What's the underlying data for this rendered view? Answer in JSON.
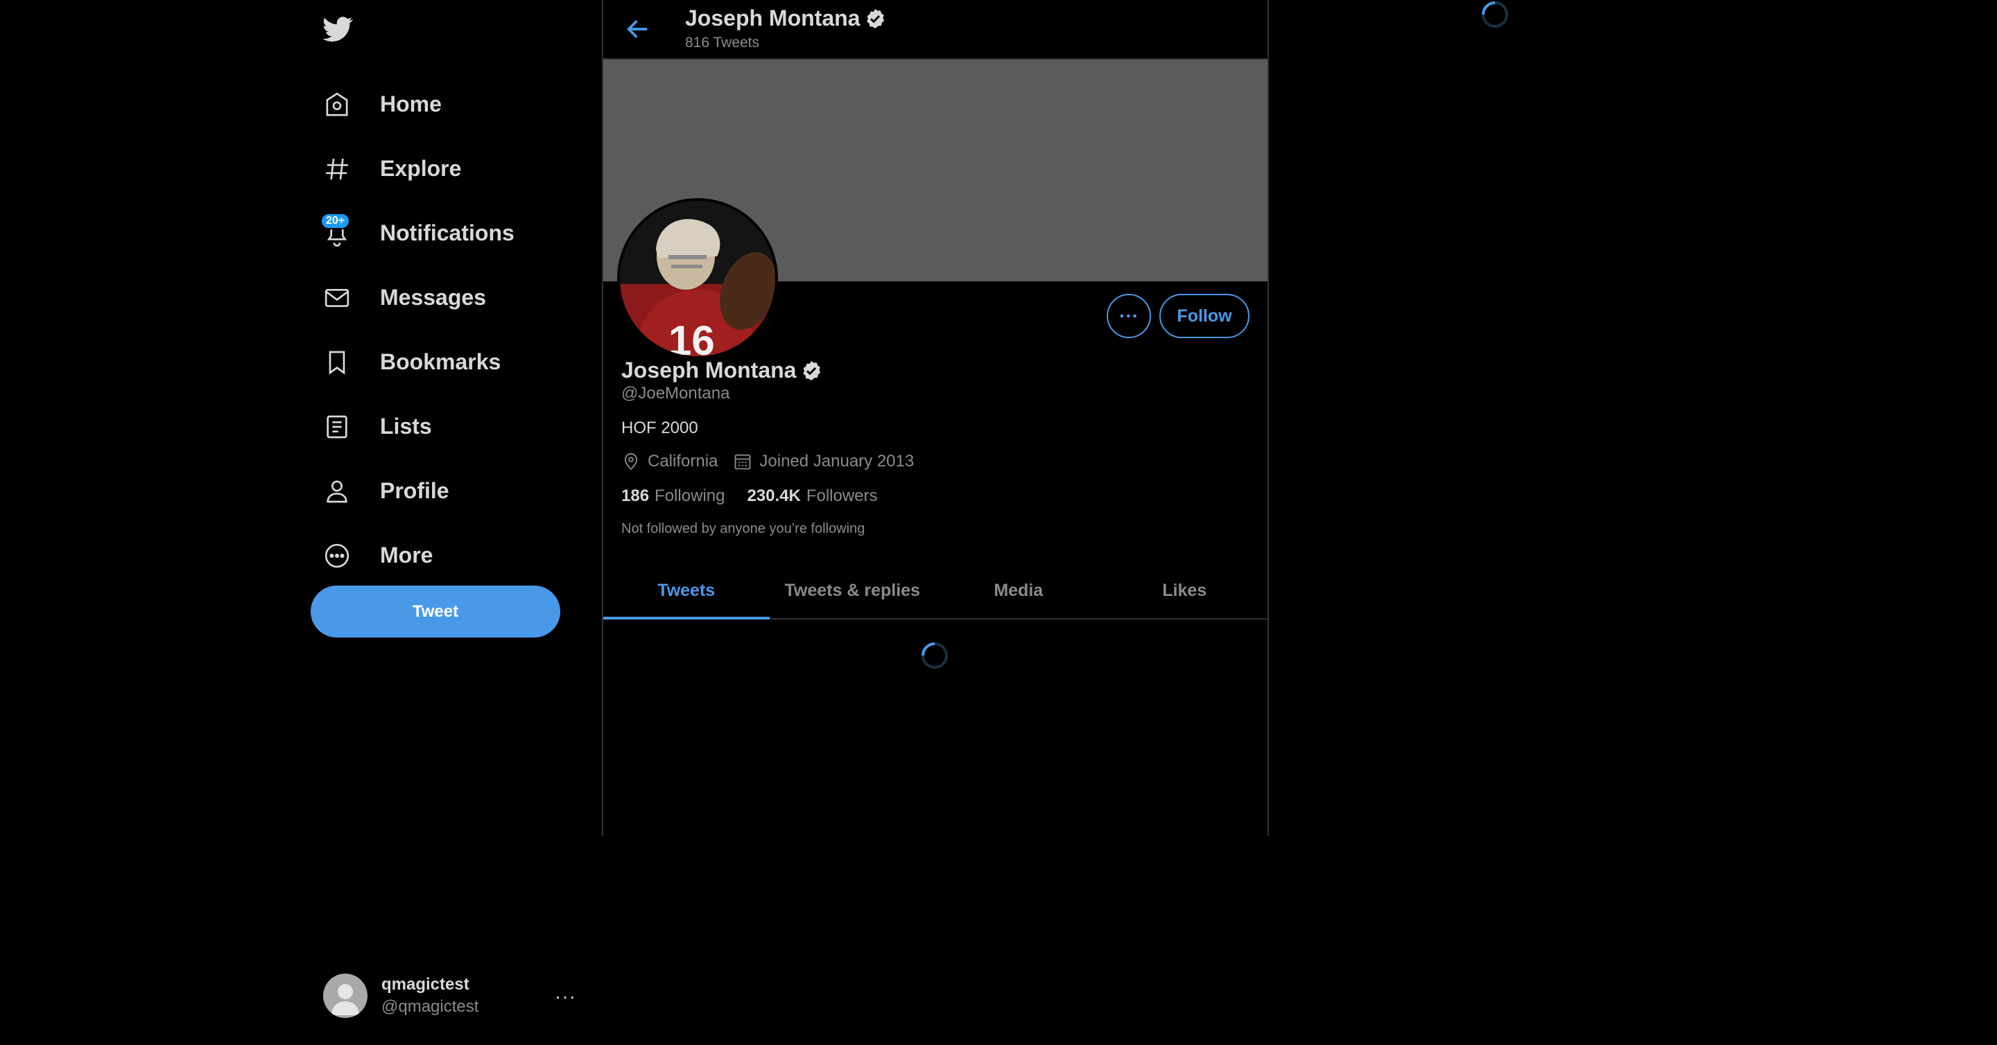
{
  "sidebar": {
    "items": [
      {
        "label": "Home",
        "icon": "home-icon"
      },
      {
        "label": "Explore",
        "icon": "hashtag-icon"
      },
      {
        "label": "Notifications",
        "icon": "bell-icon",
        "badge": "20+"
      },
      {
        "label": "Messages",
        "icon": "envelope-icon"
      },
      {
        "label": "Bookmarks",
        "icon": "bookmark-icon"
      },
      {
        "label": "Lists",
        "icon": "list-icon"
      },
      {
        "label": "Profile",
        "icon": "person-icon"
      },
      {
        "label": "More",
        "icon": "more-circle-icon"
      }
    ],
    "tweet_button": "Tweet"
  },
  "account": {
    "name": "qmagictest",
    "handle": "@qmagictest",
    "more": "···"
  },
  "header": {
    "name": "Joseph Montana",
    "tweet_count": "816 Tweets"
  },
  "profile": {
    "name": "Joseph Montana",
    "handle": "@JoeMontana",
    "bio": "HOF 2000",
    "location": "California",
    "joined": "Joined January 2013",
    "following_count": "186",
    "following_label": "Following",
    "followers_count": "230.4K",
    "followers_label": "Followers",
    "note": "Not followed by anyone you’re following",
    "more_button": "···",
    "follow_button": "Follow"
  },
  "tabs": [
    "Tweets",
    "Tweets & replies",
    "Media",
    "Likes"
  ],
  "active_tab": "Tweets",
  "colors": {
    "accent": "#4a99e9",
    "background": "#000000",
    "banner": "#5b5b5b",
    "text": "#d9d9d9",
    "secondary_text": "#8b8b8b"
  }
}
